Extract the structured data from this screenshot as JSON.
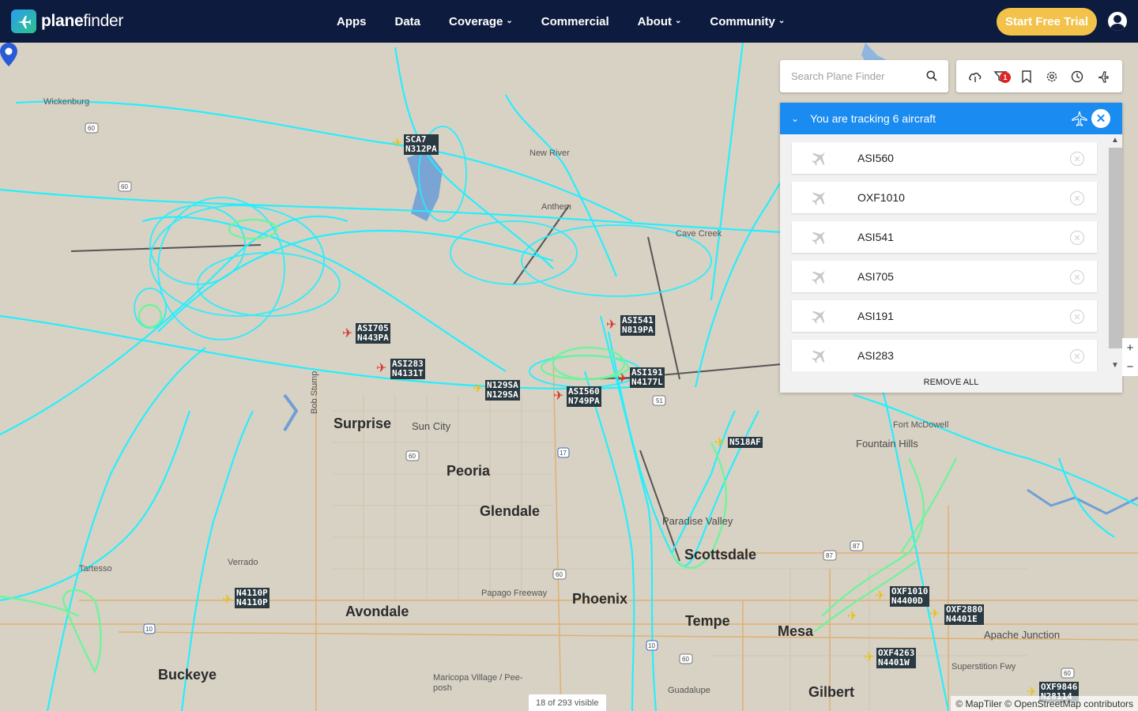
{
  "header": {
    "logo_text": "planefinder",
    "nav": [
      {
        "label": "Apps",
        "has_dropdown": false
      },
      {
        "label": "Data",
        "has_dropdown": false
      },
      {
        "label": "Coverage",
        "has_dropdown": true
      },
      {
        "label": "Commercial",
        "has_dropdown": false
      },
      {
        "label": "About",
        "has_dropdown": true
      },
      {
        "label": "Community",
        "has_dropdown": true
      }
    ],
    "cta_label": "Start Free Trial",
    "account_icon": "user-circle-icon"
  },
  "search": {
    "placeholder": "Search Plane Finder",
    "icon": "search-icon"
  },
  "toolbar": {
    "icons": [
      "cloud-icon",
      "filter-icon",
      "bookmark-icon",
      "settings-icon",
      "history-icon",
      "add-plane-icon"
    ],
    "filter_badge": "1"
  },
  "tracking_panel": {
    "title": "You are tracking 6 aircraft",
    "items": [
      {
        "callsign": "ASI560"
      },
      {
        "callsign": "OXF1010"
      },
      {
        "callsign": "ASI541"
      },
      {
        "callsign": "ASI705"
      },
      {
        "callsign": "ASI191"
      },
      {
        "callsign": "ASI283"
      }
    ],
    "remove_all_label": "REMOVE ALL"
  },
  "map": {
    "places_big": [
      "Surprise",
      "Peoria",
      "Glendale",
      "Avondale",
      "Phoenix",
      "Buckeye",
      "Tempe",
      "Scottsdale",
      "Mesa",
      "Gilbert"
    ],
    "places_small": [
      "Wickenburg",
      "New River",
      "Anthem",
      "Sun City",
      "Verrado",
      "Tartesso",
      "Papago Freeway",
      "Maricopa Village / Pee-posh",
      "Guadalupe",
      "Paradise Valley",
      "Fountain Hills",
      "Fort McDowell",
      "Apache Junction",
      "Superstition Fwy",
      "Cave Creek",
      "Bob Stump"
    ],
    "aircraft_labels": [
      {
        "line1": "SCA7",
        "line2": "N312PA",
        "color": "yellow"
      },
      {
        "line1": "ASI705",
        "line2": "N443PA",
        "color": "red"
      },
      {
        "line1": "ASI283",
        "line2": "N4131T",
        "color": "red"
      },
      {
        "line1": "N129SA",
        "line2": "N129SA",
        "color": "yellow"
      },
      {
        "line1": "ASI560",
        "line2": "N749PA",
        "color": "red"
      },
      {
        "line1": "ASI541",
        "line2": "N819PA",
        "color": "red"
      },
      {
        "line1": "ASI191",
        "line2": "N4177L",
        "color": "red"
      },
      {
        "line1": "N518AF",
        "line2": "",
        "color": "yellow"
      },
      {
        "line1": "N4110P",
        "line2": "N4110P",
        "color": "yellow"
      },
      {
        "line1": "OXF1010",
        "line2": "N4400D",
        "color": "yellow"
      },
      {
        "line1": "OXF2880",
        "line2": "N4401E",
        "color": "yellow"
      },
      {
        "line1": "OXF4263",
        "line2": "N4401W",
        "color": "yellow"
      },
      {
        "line1": "OXF9846",
        "line2": "N28114",
        "color": "yellow"
      }
    ],
    "route_shields": [
      "60",
      "60",
      "60",
      "60",
      "51",
      "17",
      "10",
      "10",
      "60",
      "87",
      "87",
      "60"
    ],
    "visible_count": "18 of 293 visible",
    "attribution": "© MapTiler © OpenStreetMap contributors"
  },
  "zoom": {
    "in_label": "+",
    "out_label": "−"
  },
  "colors": {
    "nav_bg": "#0d1b3e",
    "cta": "#f2c24a",
    "track_primary": "#1ef0ff",
    "track_secondary": "#6cf59a",
    "panel_header": "#1a8bf0",
    "map_bg": "#d8d2c5",
    "water": "#4c88c9"
  }
}
